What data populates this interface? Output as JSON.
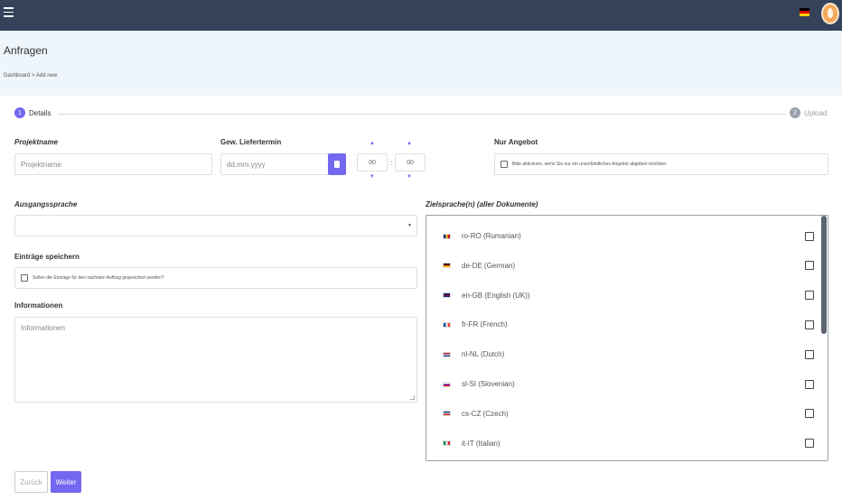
{
  "colors": {
    "topbar": "#34425a",
    "accent": "#7367f0",
    "step_inactive": "#9aa0aa",
    "header_bg": "#eef5fb"
  },
  "topbar": {
    "menu_icon": "hamburger-icon",
    "language_flag": "germany-flag-icon",
    "avatar_icon": "user-avatar-icon"
  },
  "header": {
    "title": "Anfragen",
    "breadcrumb": "Dashboard > Add new"
  },
  "stepper": {
    "steps": [
      {
        "number": "1",
        "label": "Details",
        "active": true
      },
      {
        "number": "2",
        "label": "Upload",
        "active": false
      }
    ]
  },
  "form": {
    "project_name": {
      "label": "Projektname",
      "placeholder": "Projektname"
    },
    "delivery_date": {
      "label": "Gew. Liefertermin",
      "placeholder": "dd.mm.yyyy",
      "hours": "00",
      "minutes": "00",
      "separator": ":"
    },
    "offer_only": {
      "label": "Nur Angebot",
      "checkbox_text": "Bitte aktivieren, wenn Sie nur ein unverbindliches Angebot abgeben möchten."
    },
    "source_language": {
      "label": "Ausgangssprache",
      "value": ""
    },
    "save_entries": {
      "label": "Einträge speichern",
      "checkbox_text": "Sollen die Einträge für den nächsten Auftrag gespeichert werden?"
    },
    "information": {
      "label": "Informationen",
      "placeholder": "Informationen"
    },
    "target_languages": {
      "label": "Zielsprache(n) (aller Dokumente)",
      "items": [
        {
          "label": "ro-RO (Rumanian)",
          "flag": "romania-flag-icon",
          "colors": [
            "#002b7f",
            "#fcd116",
            "#ce1126"
          ],
          "orientation": "vertical"
        },
        {
          "label": "de-DE (German)",
          "flag": "germany-flag-icon",
          "colors": [
            "#000000",
            "#dd0000",
            "#ffce00"
          ],
          "orientation": "horizontal"
        },
        {
          "label": "en-GB (English (UK))",
          "flag": "uk-flag-icon",
          "colors": [
            "#012169",
            "#c8102e",
            "#012169"
          ],
          "orientation": "horizontal"
        },
        {
          "label": "fr-FR (French)",
          "flag": "france-flag-icon",
          "colors": [
            "#0055a4",
            "#ffffff",
            "#ef4135"
          ],
          "orientation": "vertical"
        },
        {
          "label": "nl-NL (Dutch)",
          "flag": "netherlands-flag-icon",
          "colors": [
            "#ae1c28",
            "#ffffff",
            "#21468b"
          ],
          "orientation": "horizontal"
        },
        {
          "label": "sl-SI (Slovenian)",
          "flag": "slovenia-flag-icon",
          "colors": [
            "#ffffff",
            "#0000ff",
            "#ff0000"
          ],
          "orientation": "horizontal"
        },
        {
          "label": "cs-CZ (Czech)",
          "flag": "czech-flag-icon",
          "colors": [
            "#11457e",
            "#ffffff",
            "#d7141a"
          ],
          "orientation": "horizontal"
        },
        {
          "label": "it-IT (Italian)",
          "flag": "italy-flag-icon",
          "colors": [
            "#009246",
            "#ffffff",
            "#ce2b37"
          ],
          "orientation": "vertical"
        }
      ]
    }
  },
  "buttons": {
    "back": "Zurück",
    "next": "Weiter"
  }
}
